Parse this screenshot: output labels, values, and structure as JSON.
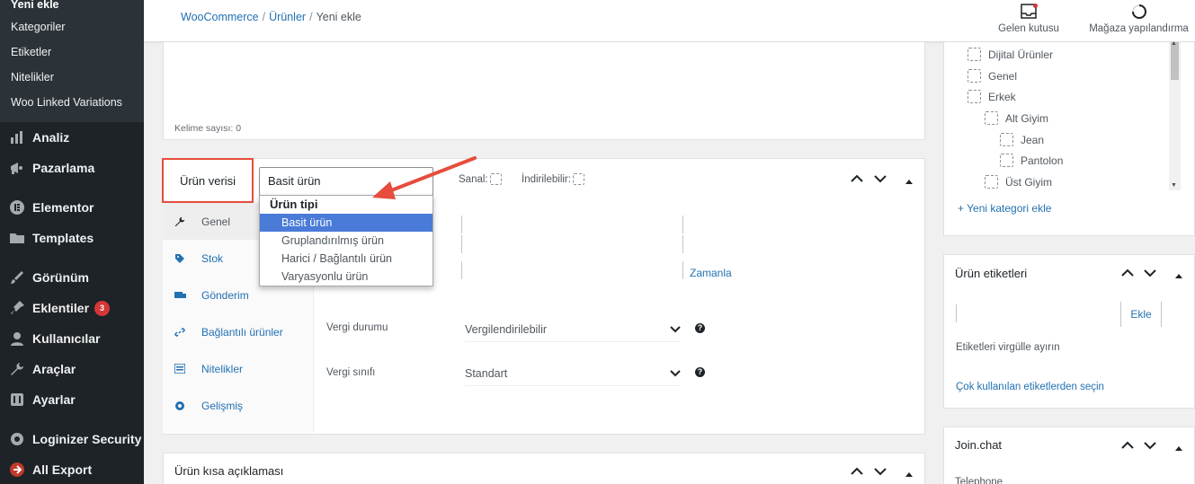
{
  "sidebar": {
    "current_item": "Yeni ekle",
    "submenu": [
      "Kategoriler",
      "Etiketler",
      "Nitelikler",
      "Woo Linked Variations"
    ],
    "menu": [
      {
        "label": "Analiz",
        "icon": "chart-icon"
      },
      {
        "label": "Pazarlama",
        "icon": "megaphone-icon"
      },
      {
        "label": "Elementor",
        "icon": "elementor-icon"
      },
      {
        "label": "Templates",
        "icon": "folder-icon"
      },
      {
        "label": "Görünüm",
        "icon": "brush-icon"
      },
      {
        "label": "Eklentiler",
        "icon": "plugin-icon",
        "badge": "3"
      },
      {
        "label": "Kullanıcılar",
        "icon": "user-icon"
      },
      {
        "label": "Araçlar",
        "icon": "wrench-icon"
      },
      {
        "label": "Ayarlar",
        "icon": "settings-icon"
      },
      {
        "label": "Loginizer Security",
        "icon": "gear-icon"
      },
      {
        "label": "All Export",
        "icon": "export-icon"
      }
    ]
  },
  "topbar": {
    "breadcrumb": [
      "WooCommerce",
      "Ürünler",
      "Yeni ekle"
    ],
    "actions": [
      {
        "label": "Gelen kutusu",
        "icon": "inbox-icon"
      },
      {
        "label": "Mağaza yapılandırma",
        "icon": "progress-icon"
      }
    ]
  },
  "editor": {
    "word_count": "Kelime sayısı: 0"
  },
  "product_data": {
    "title": "Ürün verisi",
    "type_select_value": "Basit ürün",
    "dropdown": {
      "group_label": "Ürün tipi",
      "options": [
        "Basit ürün",
        "Gruplandırılmış ürün",
        "Harici / Bağlantılı ürün",
        "Varyasyonlu ürün"
      ],
      "selected_index": 0
    },
    "virtual_label": "Sanal:",
    "downloadable_label": "İndirilebilir:",
    "tabs": [
      {
        "label": "Genel",
        "icon": "wrench-icon"
      },
      {
        "label": "Stok",
        "icon": "tag-icon"
      },
      {
        "label": "Gönderim",
        "icon": "truck-icon"
      },
      {
        "label": "Bağlantılı ürünler",
        "icon": "link-icon"
      },
      {
        "label": "Nitelikler",
        "icon": "list-icon"
      },
      {
        "label": "Gelişmiş",
        "icon": "gear-icon"
      }
    ],
    "schedule_link": "Zamanla",
    "tax_status_label": "Vergi durumu",
    "tax_status_value": "Vergilendirilebilir",
    "tax_class_label": "Vergi sınıfı",
    "tax_class_value": "Standart"
  },
  "short_description": {
    "title": "Ürün kısa açıklaması"
  },
  "categories": {
    "items": [
      {
        "label": "Dijital Ürünler",
        "level": 0
      },
      {
        "label": "Genel",
        "level": 0
      },
      {
        "label": "Erkek",
        "level": 0
      },
      {
        "label": "Alt Giyim",
        "level": 1
      },
      {
        "label": "Jean",
        "level": 2
      },
      {
        "label": "Pantolon",
        "level": 2
      },
      {
        "label": "Üst Giyim",
        "level": 1
      }
    ],
    "add_link": "+ Yeni kategori ekle"
  },
  "tags": {
    "title": "Ürün etiketleri",
    "add_button": "Ekle",
    "hint": "Etiketleri virgülle ayırın",
    "popular_link": "Çok kullanılan etiketlerden seçin"
  },
  "joinchat": {
    "title": "Join.chat",
    "partial_label": "Telephone"
  },
  "colors": {
    "highlight": "#e74c3c",
    "selected": "#4a7bd8",
    "sidebar_bg": "#1d2327",
    "link": "#2271b1"
  }
}
